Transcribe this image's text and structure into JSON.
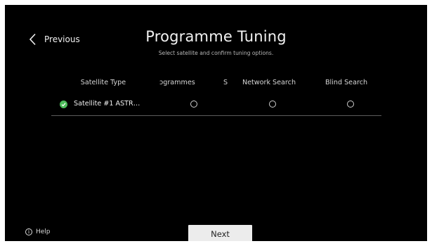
{
  "nav": {
    "back_label": "Previous",
    "back_icon": "chevron-left-icon"
  },
  "header": {
    "title": "Programme Tuning",
    "subtitle": "Select satellite and confirm tuning options."
  },
  "table": {
    "columns": [
      "Satellite Type",
      "ɔgrammes",
      "S",
      "Network Search",
      "Blind Search"
    ],
    "rows": [
      {
        "status_icon": "check-circle-icon",
        "status_color": "#4cbb5a",
        "satellite": "Satellite #1 ASTR…",
        "programmes": false,
        "network_search": false,
        "blind_search": false
      }
    ]
  },
  "footer": {
    "help_label": "Help",
    "help_icon": "info-icon",
    "next_label": "Next"
  }
}
